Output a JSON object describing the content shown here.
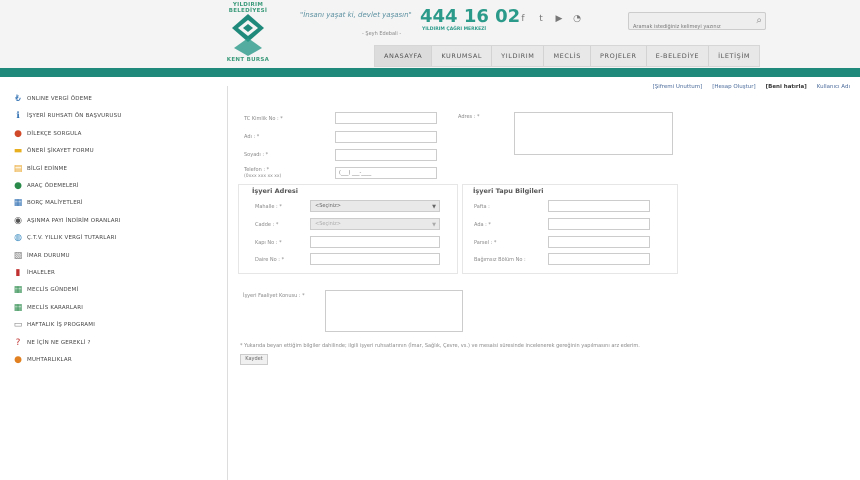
{
  "header": {
    "logo_text": "YILDIRIM BELEDİYESİ",
    "logo_sub": "KENT BURSA",
    "slogan": "\"İnsanı yaşat ki, devlet yaşasın\"",
    "slogan_author": "- Şeyh Edebali -",
    "phone": "444 16 02",
    "phone_sub": "YILDIRIM ÇAĞRI MERKEZİ",
    "search_placeholder": "Aramak istediğiniz kelimeyi yazınız"
  },
  "nav": [
    "ANASAYFA",
    "KURUMSAL",
    "YILDIRIM",
    "MECLİS",
    "PROJELER",
    "E-BELEDİYE",
    "İLETİŞİM"
  ],
  "sidebar": [
    {
      "label": "ONLINE VERGİ ÖDEME",
      "icon": "tl-icon",
      "color": "#2a6bb0",
      "glyph": "₺"
    },
    {
      "label": "İŞYERİ RUHSATI ÖN BAŞVURUSU",
      "icon": "info-icon",
      "color": "#2a6bb0",
      "glyph": "ℹ"
    },
    {
      "label": "DİLEKÇE SORGULA",
      "icon": "pin-icon",
      "color": "#d04a2a",
      "glyph": "●"
    },
    {
      "label": "ÖNERİ ŞİKAYET FORMU",
      "icon": "folder-icon",
      "color": "#e8b020",
      "glyph": "▬"
    },
    {
      "label": "BİLGİ EDİNME",
      "icon": "document-icon",
      "color": "#e8a020",
      "glyph": "▤"
    },
    {
      "label": "ARAÇ ÖDEMELERİ",
      "icon": "person-icon",
      "color": "#2a8a4a",
      "glyph": "●"
    },
    {
      "label": "BORÇ MALİYETLERİ",
      "icon": "table-icon",
      "color": "#2a6bb0",
      "glyph": "▦"
    },
    {
      "label": "AŞINMA PAYI İNDİRİM ORANLARI",
      "icon": "search-circle-icon",
      "color": "#555",
      "glyph": "◉"
    },
    {
      "label": "Ç.T.V. YILLIK VERGİ TUTARLARI",
      "icon": "globe-icon",
      "color": "#3a8ac0",
      "glyph": "◍"
    },
    {
      "label": "İMAR DURUMU",
      "icon": "map-icon",
      "color": "#7a7a7a",
      "glyph": "▧"
    },
    {
      "label": "İHALELER",
      "icon": "book-icon",
      "color": "#c03030",
      "glyph": "▮"
    },
    {
      "label": "MECLİS GÜNDEMİ",
      "icon": "grid-icon",
      "color": "#2a8a4a",
      "glyph": "▦"
    },
    {
      "label": "MECLİS KARARLARI",
      "icon": "spreadsheet-icon",
      "color": "#2a8a4a",
      "glyph": "▦"
    },
    {
      "label": "HAFTALIK İŞ PROGRAMI",
      "icon": "calendar-icon",
      "color": "#7a7a7a",
      "glyph": "▭"
    },
    {
      "label": "NE İÇİN NE GEREKLİ ?",
      "icon": "question-icon",
      "color": "#c03030",
      "glyph": "?"
    },
    {
      "label": "MUHTARLIKLAR",
      "icon": "people-icon",
      "color": "#e08020",
      "glyph": "●"
    }
  ],
  "links": {
    "link1": "[Şifremi Unuttum]",
    "link2": "[Hesap Oluştur]",
    "link3": "[Beni hatırla]",
    "link4": "Kullanıcı Adı"
  },
  "form": {
    "tc_label": "TC Kimlik No : *",
    "ad_label": "Adı : *",
    "soyad_label": "Soyadı : *",
    "telefon_label": "Telefon : *",
    "telefon_hint": "(0xxx xxx xx xx)",
    "telefon_value": "(___) ___-____",
    "adres_label": "Adres : *",
    "isyeri_adresi_title": "İşyeri Adresi",
    "mahalle_label": "Mahalle : *",
    "mahalle_value": "<Seçiniz>",
    "cadde_label": "Cadde : *",
    "cadde_value": "<Seçiniz>",
    "kapi_label": "Kapı No : *",
    "daire_label": "Daire No : *",
    "tapu_title": "İşyeri Tapu Bilgileri",
    "pafta_label": "Pafta :",
    "ada_label": "Ada : *",
    "parsel_label": "Parsel : *",
    "bagimsiz_label": "Bağımsız Bölüm No :",
    "faaliyet_label": "İşyeri Faaliyet Konusu : *",
    "note": "* Yukarıda beyan ettiğim bilgiler dahilinde; ilgili işyeri ruhsatlarının (İmar, Sağlık, Çevre, vs.) ve mesaisi süresinde incelenerek gereğinin yapılmasını arz ederim.",
    "submit": "Kaydet"
  }
}
